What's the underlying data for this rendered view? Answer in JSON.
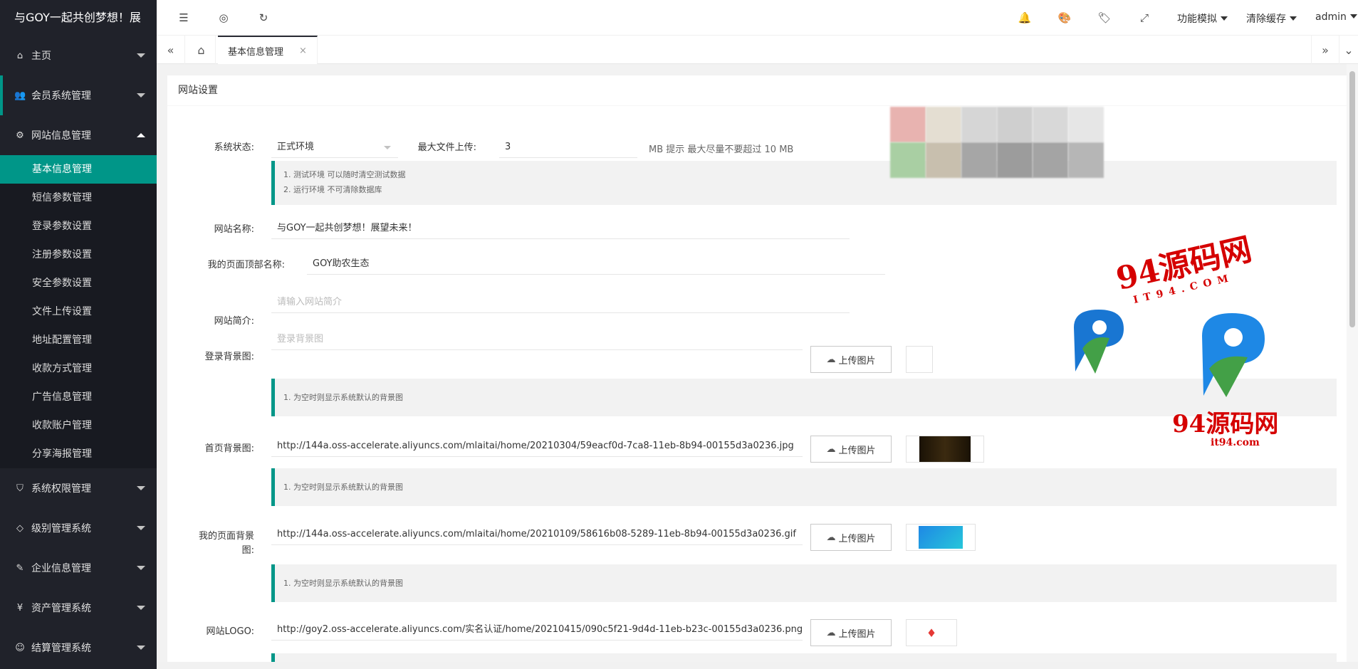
{
  "app": {
    "title": "与GOY一起共创梦想！展"
  },
  "sidebar": {
    "items": [
      {
        "label": "主页",
        "icon": "home-icon"
      },
      {
        "label": "会员系统管理",
        "icon": "users-icon"
      },
      {
        "label": "网站信息管理",
        "icon": "gear-icon"
      },
      {
        "label": "系统权限管理",
        "icon": "shield-icon"
      },
      {
        "label": "级别管理系统",
        "icon": "diamond-icon"
      },
      {
        "label": "企业信息管理",
        "icon": "edit-icon"
      },
      {
        "label": "资产管理系统",
        "icon": "yen-icon"
      },
      {
        "label": "结算管理系统",
        "icon": "smile-icon"
      }
    ],
    "sub": [
      "基本信息管理",
      "短信参数管理",
      "登录参数设置",
      "注册参数设置",
      "安全参数设置",
      "文件上传设置",
      "地址配置管理",
      "收款方式管理",
      "广告信息管理",
      "收款账户管理",
      "分享海报管理"
    ]
  },
  "header": {
    "menu1": "功能模拟",
    "menu2": "清除缓存",
    "user": "admin"
  },
  "tabs": {
    "active": "基本信息管理",
    "close": "×"
  },
  "card": {
    "title": "网站设置"
  },
  "form": {
    "status_label": "系统状态:",
    "status_value": "正式环境",
    "maxfile_label": "最大文件上传:",
    "maxfile_value": "3",
    "maxfile_hint": "MB 提示 最大尽量不要超过 10 MB",
    "status_tips": [
      "1. 测试环境 可以随时清空测试数据",
      "2. 运行环境 不可清除数据库"
    ],
    "sitename_label": "网站名称:",
    "sitename_value": "与GOY一起共创梦想！展望未来！",
    "topname_label": "我的页面顶部名称:",
    "topname_value": "GOY助农生态",
    "intro_label": "网站简介:",
    "intro_placeholder": "请输入网站简介",
    "loginbg_label": "登录背景图:",
    "loginbg_placeholder": "登录背景图",
    "default_tip": "1. 为空时则显示系统默认的背景图",
    "homebg_label": "首页背景图:",
    "homebg_value": "http://144a.oss-accelerate.aliyuncs.com/mlaitai/home/20210304/59eacf0d-7ca8-11eb-8b94-00155d3a0236.jpg",
    "mybg_label": "我的页面背景图:",
    "mybg_value": "http://144a.oss-accelerate.aliyuncs.com/mlaitai/home/20210109/58616b08-5289-11eb-8b94-00155d3a0236.gif",
    "logo_label": "网站LOGO:",
    "logo_value": "http://goy2.oss-accelerate.aliyuncs.com/实名认证/home/20210415/090c5f21-9d4d-11eb-b23c-00155d3a0236.png",
    "upload_label": "上传图片"
  },
  "watermark": {
    "big": "94源码网",
    "site": "IT94.COM",
    "small": "94源码网",
    "url": "it94.com"
  }
}
